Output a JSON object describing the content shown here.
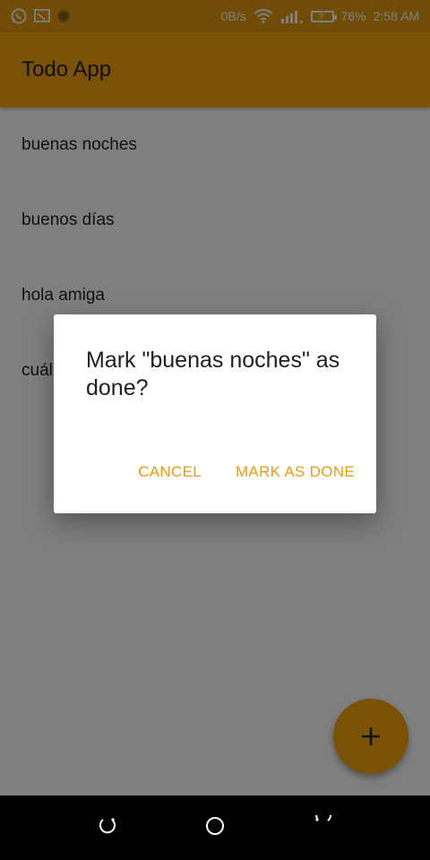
{
  "status_bar": {
    "net_speed": "0B/s",
    "battery_percent": "76%",
    "time": "2:58 AM",
    "icons": [
      "whatsapp-icon",
      "cast-icon",
      "app-icon",
      "wifi-icon",
      "signal-icon",
      "battery-charging-icon"
    ]
  },
  "app_bar": {
    "title": "Todo App"
  },
  "todos": [
    {
      "text": "buenas noches"
    },
    {
      "text": "buenos días"
    },
    {
      "text": "hola amiga"
    },
    {
      "text": "cuál"
    }
  ],
  "fab": {
    "icon": "plus-icon"
  },
  "dialog": {
    "title": "Mark \"buenas noches\" as done?",
    "cancel_label": "CANCEL",
    "confirm_label": "MARK AS DONE"
  },
  "nav_bar": {
    "icons": [
      "back-icon",
      "home-icon",
      "recents-icon"
    ]
  },
  "colors": {
    "accent": "#f3a40d",
    "status_bar": "#e0990f",
    "button_text": "#f0990d",
    "nav_bar": "#000000"
  }
}
